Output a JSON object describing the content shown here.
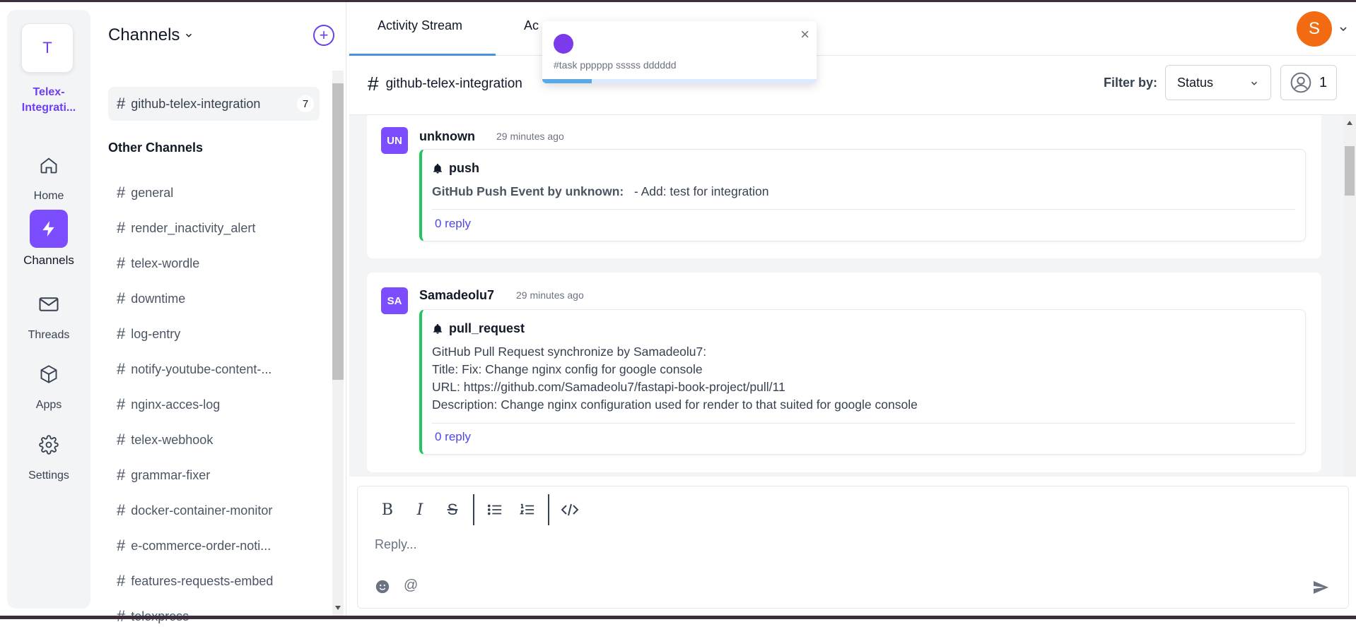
{
  "workspace": {
    "initial": "T",
    "name": "Telex-Integrati..."
  },
  "rail": {
    "items": [
      {
        "label": "Home",
        "icon": "home-icon"
      },
      {
        "label": "Channels",
        "icon": "lightning-icon",
        "active": true
      },
      {
        "label": "Threads",
        "icon": "mail-icon"
      },
      {
        "label": "Apps",
        "icon": "cube-icon"
      },
      {
        "label": "Settings",
        "icon": "gear-icon"
      }
    ]
  },
  "channels": {
    "title": "Channels",
    "active": {
      "name": "github-telex-integration",
      "count": "7"
    },
    "other_title": "Other Channels",
    "other": [
      "general",
      "render_inactivity_alert",
      "telex-wordle",
      "downtime",
      "log-entry",
      "notify-youtube-content-...",
      "nginx-acces-log",
      "telex-webhook",
      "grammar-fixer",
      "docker-container-monitor",
      "e-commerce-order-noti...",
      "features-requests-embed",
      "telexpress"
    ]
  },
  "tabs": {
    "activity_stream": "Activity Stream",
    "second": "Ac"
  },
  "user_avatar": {
    "initial": "S",
    "color": "#f26a12"
  },
  "header": {
    "channel_name": "github-telex-integration",
    "filter_label": "Filter by:",
    "status_value": "Status",
    "members_count": "1"
  },
  "messages": [
    {
      "avatar": "UN",
      "user": "unknown",
      "time": "29 minutes ago",
      "event": "push",
      "body_bold": "GitHub Push Event by unknown:",
      "body_text": "- Add: test for integration",
      "reply": "0 reply"
    },
    {
      "avatar": "SA",
      "user": "Samadeolu7",
      "time": "29 minutes ago",
      "event": "pull_request",
      "lines": [
        "GitHub Pull Request synchronize by Samadeolu7:",
        "Title: Fix: Change nginx config for google console",
        "URL: https://github.com/Samadeolu7/fastapi-book-project/pull/11",
        "Description: Change nginx configuration used for render to that suited for google console"
      ],
      "reply": "0 reply"
    }
  ],
  "composer": {
    "placeholder": "Reply..."
  },
  "toast": {
    "text": "#task pppppp sssss dddddd",
    "close": "×",
    "progress": 0.18
  },
  "colors": {
    "accent": "#7c4dff",
    "success": "#22c55e",
    "link": "#4f46e5"
  }
}
